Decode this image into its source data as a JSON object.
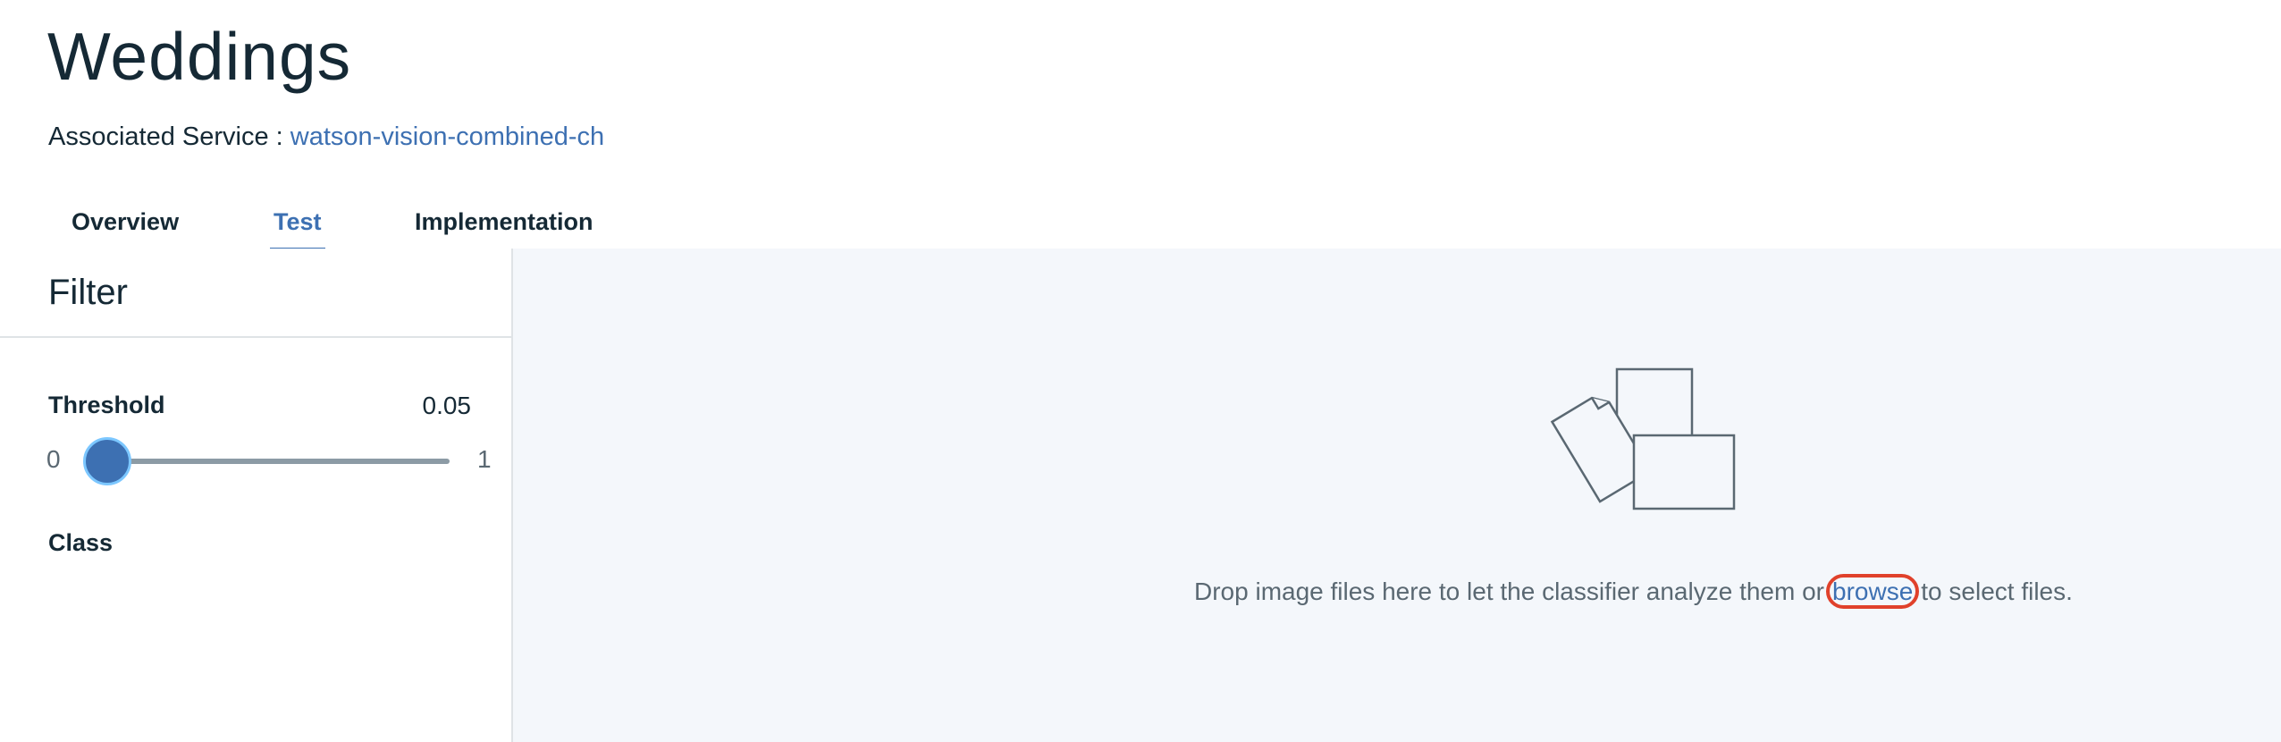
{
  "page": {
    "title": "Weddings",
    "service_label": "Associated Service :",
    "service_link": "watson-vision-combined-ch"
  },
  "tabs": [
    {
      "label": "Overview",
      "active": false
    },
    {
      "label": "Test",
      "active": true
    },
    {
      "label": "Implementation",
      "active": false
    }
  ],
  "filter": {
    "title": "Filter",
    "threshold_label": "Threshold",
    "threshold_value": "0.05",
    "slider_min": "0",
    "slider_max": "1",
    "slider_position": 0.05,
    "class_label": "Class"
  },
  "dropzone": {
    "icon": "image-files-icon",
    "text_before": "Drop image files here to let the classifier analyze them or",
    "browse_label": "browse",
    "text_after": "to select files."
  },
  "colors": {
    "accent": "#3d70b2",
    "highlight": "#e0412b",
    "thumb_ring": "#7cc7ff",
    "dropzone_bg": "#f4f7fb"
  }
}
